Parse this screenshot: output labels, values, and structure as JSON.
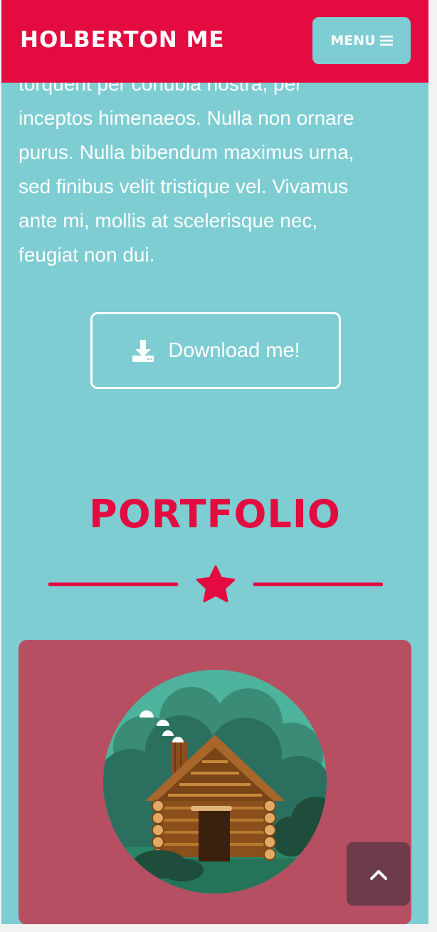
{
  "navbar": {
    "brand": "HOLBERTON ME",
    "menu_label": "MENU",
    "menu_icon": "bars-icon",
    "background": "#e30b40"
  },
  "about": {
    "lines": [
      "torquent per conubia nostra, per",
      "inceptos himenaeos. Nulla non ornare",
      "purus. Nulla bibendum maximus urna,",
      "sed finibus velit tristique vel. Vivamus",
      "ante mi, mollis at scelerisque nec,",
      "feugiat non dui."
    ],
    "download_label": "Download me!",
    "download_icon": "download-icon"
  },
  "portfolio": {
    "title": "PORTFOLIO",
    "divider_icon": "star-icon",
    "items": [
      {
        "image": "log-cabin-illustration"
      }
    ]
  },
  "scroll_top": {
    "icon": "chevron-up-icon"
  },
  "colors": {
    "primary": "#e30b40",
    "teal": "#7ecdd3",
    "card": "#b74f62",
    "scroll_button": "#6d3c4a"
  }
}
